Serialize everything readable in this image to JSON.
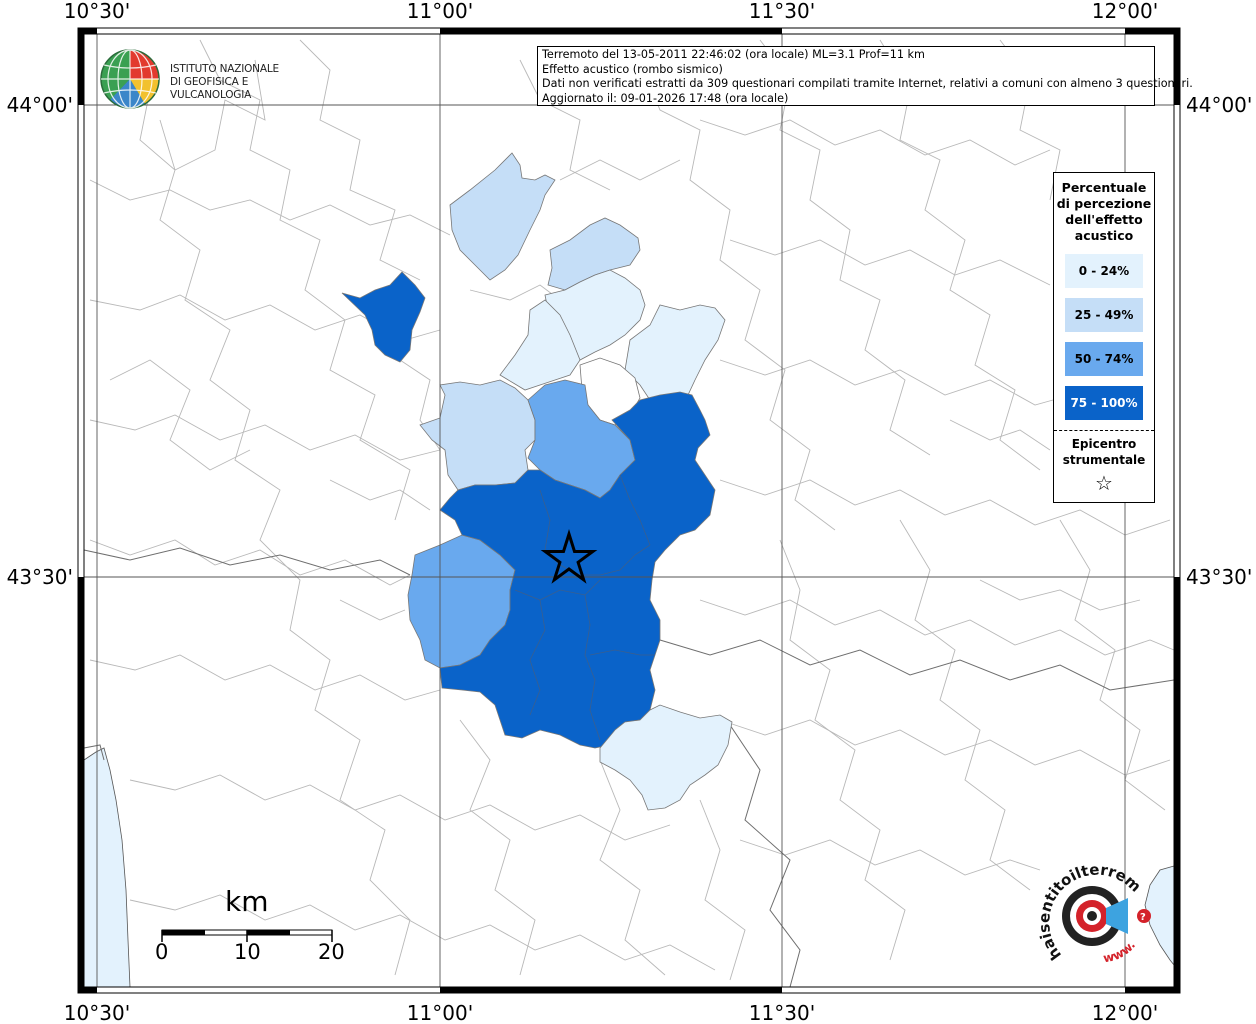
{
  "map": {
    "lon_ticks": [
      "10°30'",
      "11°00'",
      "11°30'",
      "12°00'"
    ],
    "lat_ticks": [
      "44°00'",
      "43°30'"
    ]
  },
  "info": {
    "line1": "Terremoto del 13-05-2011 22:46:02 (ora locale) ML=3.1 Prof=11 km",
    "line2": "Effetto acustico (rombo sismico)",
    "line3": "Dati non verificati estratti da 309 questionari compilati tramite Internet, relativi a comuni con almeno 3 questionari.",
    "line4": "Aggiornato il: 09-01-2026 17:48 (ora locale)"
  },
  "institute": {
    "line1": "ISTITUTO NAZIONALE",
    "line2": "DI GEOFISICA E VULCANOLOGIA"
  },
  "legend": {
    "title": "Percentuale di percezione dell'effetto acustico",
    "classes": [
      {
        "label": "0 - 24%",
        "color": "#e3f2fd"
      },
      {
        "label": "25 - 49%",
        "color": "#c5def7"
      },
      {
        "label": "50 - 74%",
        "color": "#69a9ee"
      },
      {
        "label": "75 - 100%",
        "color": "#0a63c9"
      }
    ],
    "epicenter_label": "Epicentro strumentale",
    "epicenter_symbol": "☆"
  },
  "scale": {
    "unit": "km",
    "labels": [
      "0",
      "10",
      "20"
    ]
  },
  "brand": {
    "text": "haisentitoilterremoto.it",
    "www": "www."
  }
}
